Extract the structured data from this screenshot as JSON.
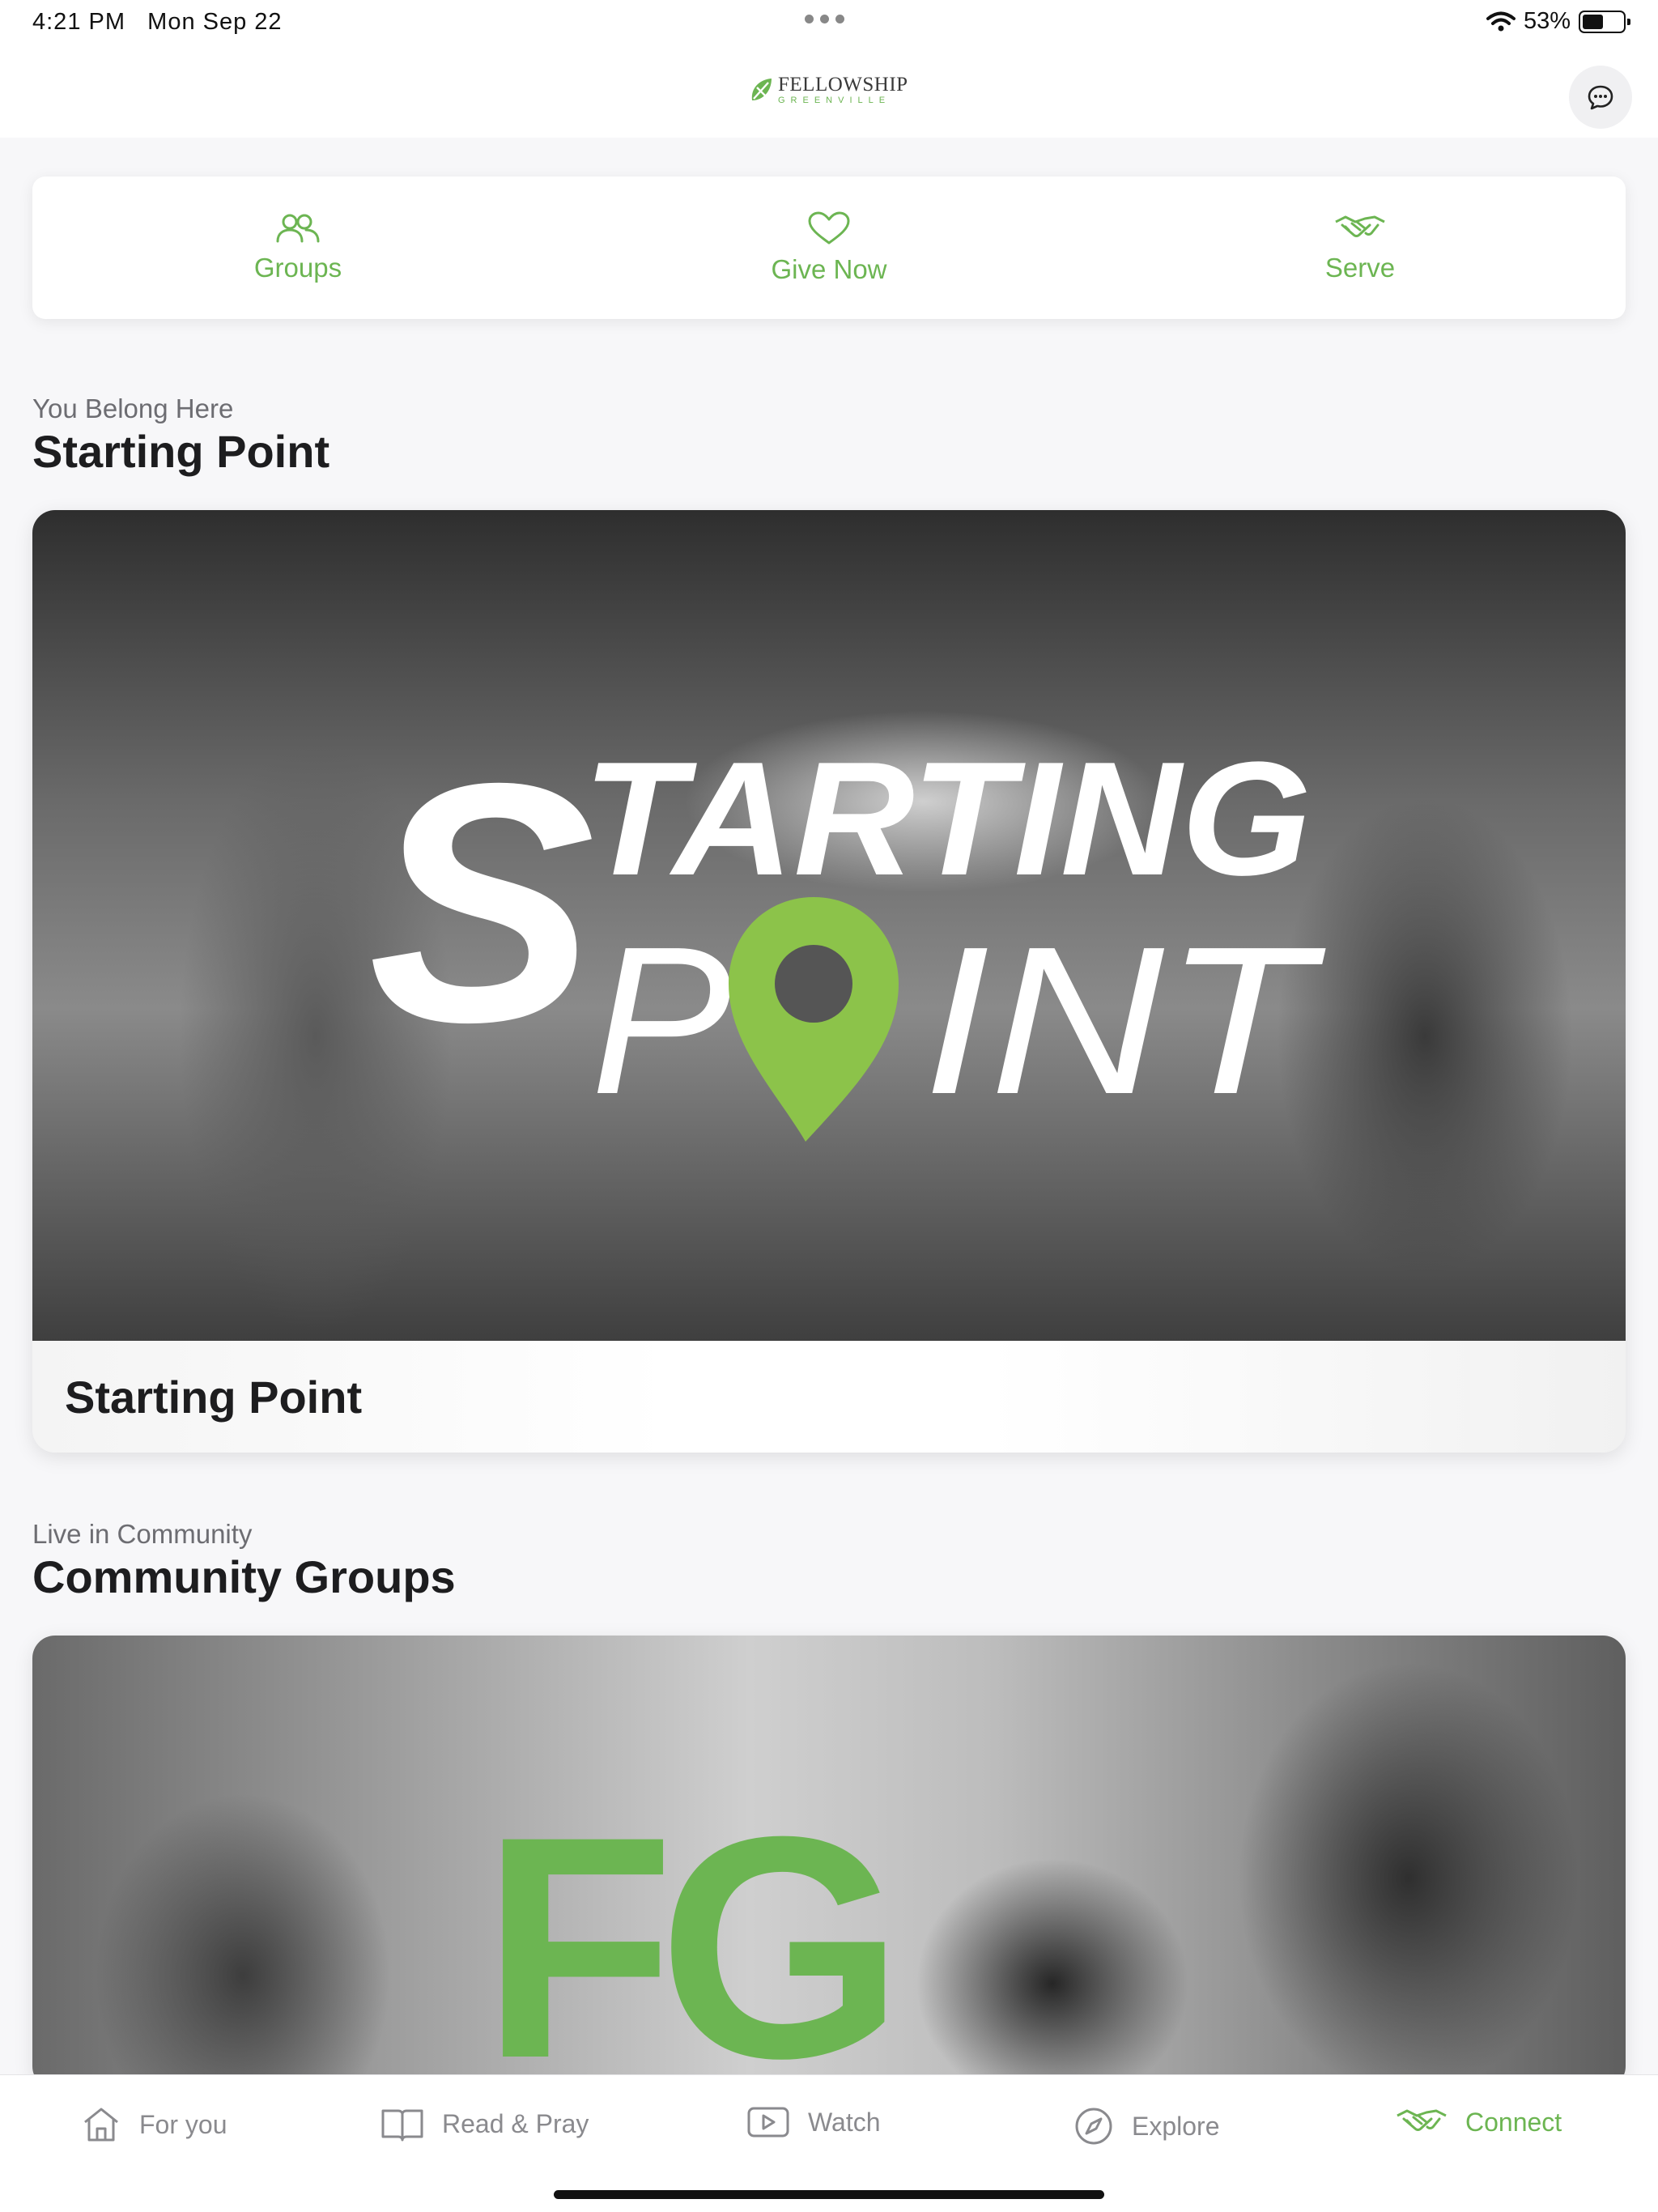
{
  "status_bar": {
    "time": "4:21 PM",
    "date": "Mon Sep 22",
    "battery": "53%",
    "battery_level": 0.53
  },
  "header": {
    "logo_line1": "FELLOWSHIP",
    "logo_line2": "GREENVILLE",
    "chat_icon": "chat-bubble-icon"
  },
  "quick_actions": [
    {
      "label": "Groups",
      "icon": "groups-icon"
    },
    {
      "label": "Give Now",
      "icon": "heart-icon"
    },
    {
      "label": "Serve",
      "icon": "handshake-icon"
    }
  ],
  "sections": [
    {
      "eyebrow": "You Belong Here",
      "title": "Starting Point",
      "card": {
        "caption": "Starting Point",
        "graphic_text_1": "STARTING",
        "graphic_text_2": "POINT"
      }
    },
    {
      "eyebrow": "Live in Community",
      "title": "Community Groups",
      "card": {
        "graphic_text": "FG"
      }
    }
  ],
  "tab_bar": [
    {
      "label": "For you",
      "icon": "home-icon",
      "active": false
    },
    {
      "label": "Read & Pray",
      "icon": "book-icon",
      "active": false
    },
    {
      "label": "Watch",
      "icon": "play-icon",
      "active": false
    },
    {
      "label": "Explore",
      "icon": "compass-icon",
      "active": false
    },
    {
      "label": "Connect",
      "icon": "handshake-icon",
      "active": true
    }
  ],
  "colors": {
    "accent": "#6cb552",
    "inactive": "#8a8a8e",
    "background": "#f7f7f9"
  }
}
